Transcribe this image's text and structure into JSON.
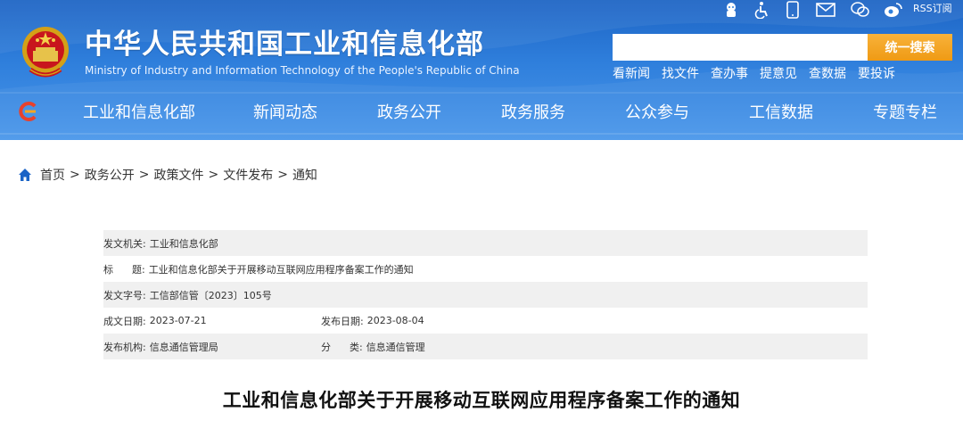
{
  "header": {
    "title": "中华人民共和国工业和信息化部",
    "subtitle": "Ministry of Industry and Information Technology of the People's Republic of China",
    "top_icons": [
      "robot-icon",
      "accessibility-icon",
      "mobile-icon",
      "mail-icon",
      "wechat-icon",
      "weibo-icon"
    ],
    "rss_label": "RSS订阅",
    "search": {
      "placeholder": "",
      "button_label": "统一搜索"
    },
    "quick_links": [
      "看新闻",
      "找文件",
      "查办事",
      "提意见",
      "查数据",
      "要投诉"
    ],
    "nav": [
      "工业和信息化部",
      "新闻动态",
      "政务公开",
      "政务服务",
      "公众参与",
      "工信数据",
      "专题专栏"
    ],
    "colors": {
      "header_bg": "#2f7fdc",
      "search_button": "#f5a623"
    }
  },
  "breadcrumb": [
    "首页",
    "政务公开",
    "政策文件",
    "文件发布",
    "通知"
  ],
  "metadata": {
    "issuer_label": "发文机关:",
    "issuer": "工业和信息化部",
    "title_label": "标      题:",
    "title": "工业和信息化部关于开展移动互联网应用程序备案工作的通知",
    "doc_no_label": "发文字号:",
    "doc_no": "工信部信管〔2023〕105号",
    "written_date_label": "成文日期:",
    "written_date": "2023-07-21",
    "publish_date_label": "发布日期:",
    "publish_date": "2023-08-04",
    "org_label": "发布机构:",
    "org": "信息通信管理局",
    "category_label": "分      类:",
    "category": "信息通信管理"
  },
  "article": {
    "title": "工业和信息化部关于开展移动互联网应用程序备案工作的通知"
  }
}
